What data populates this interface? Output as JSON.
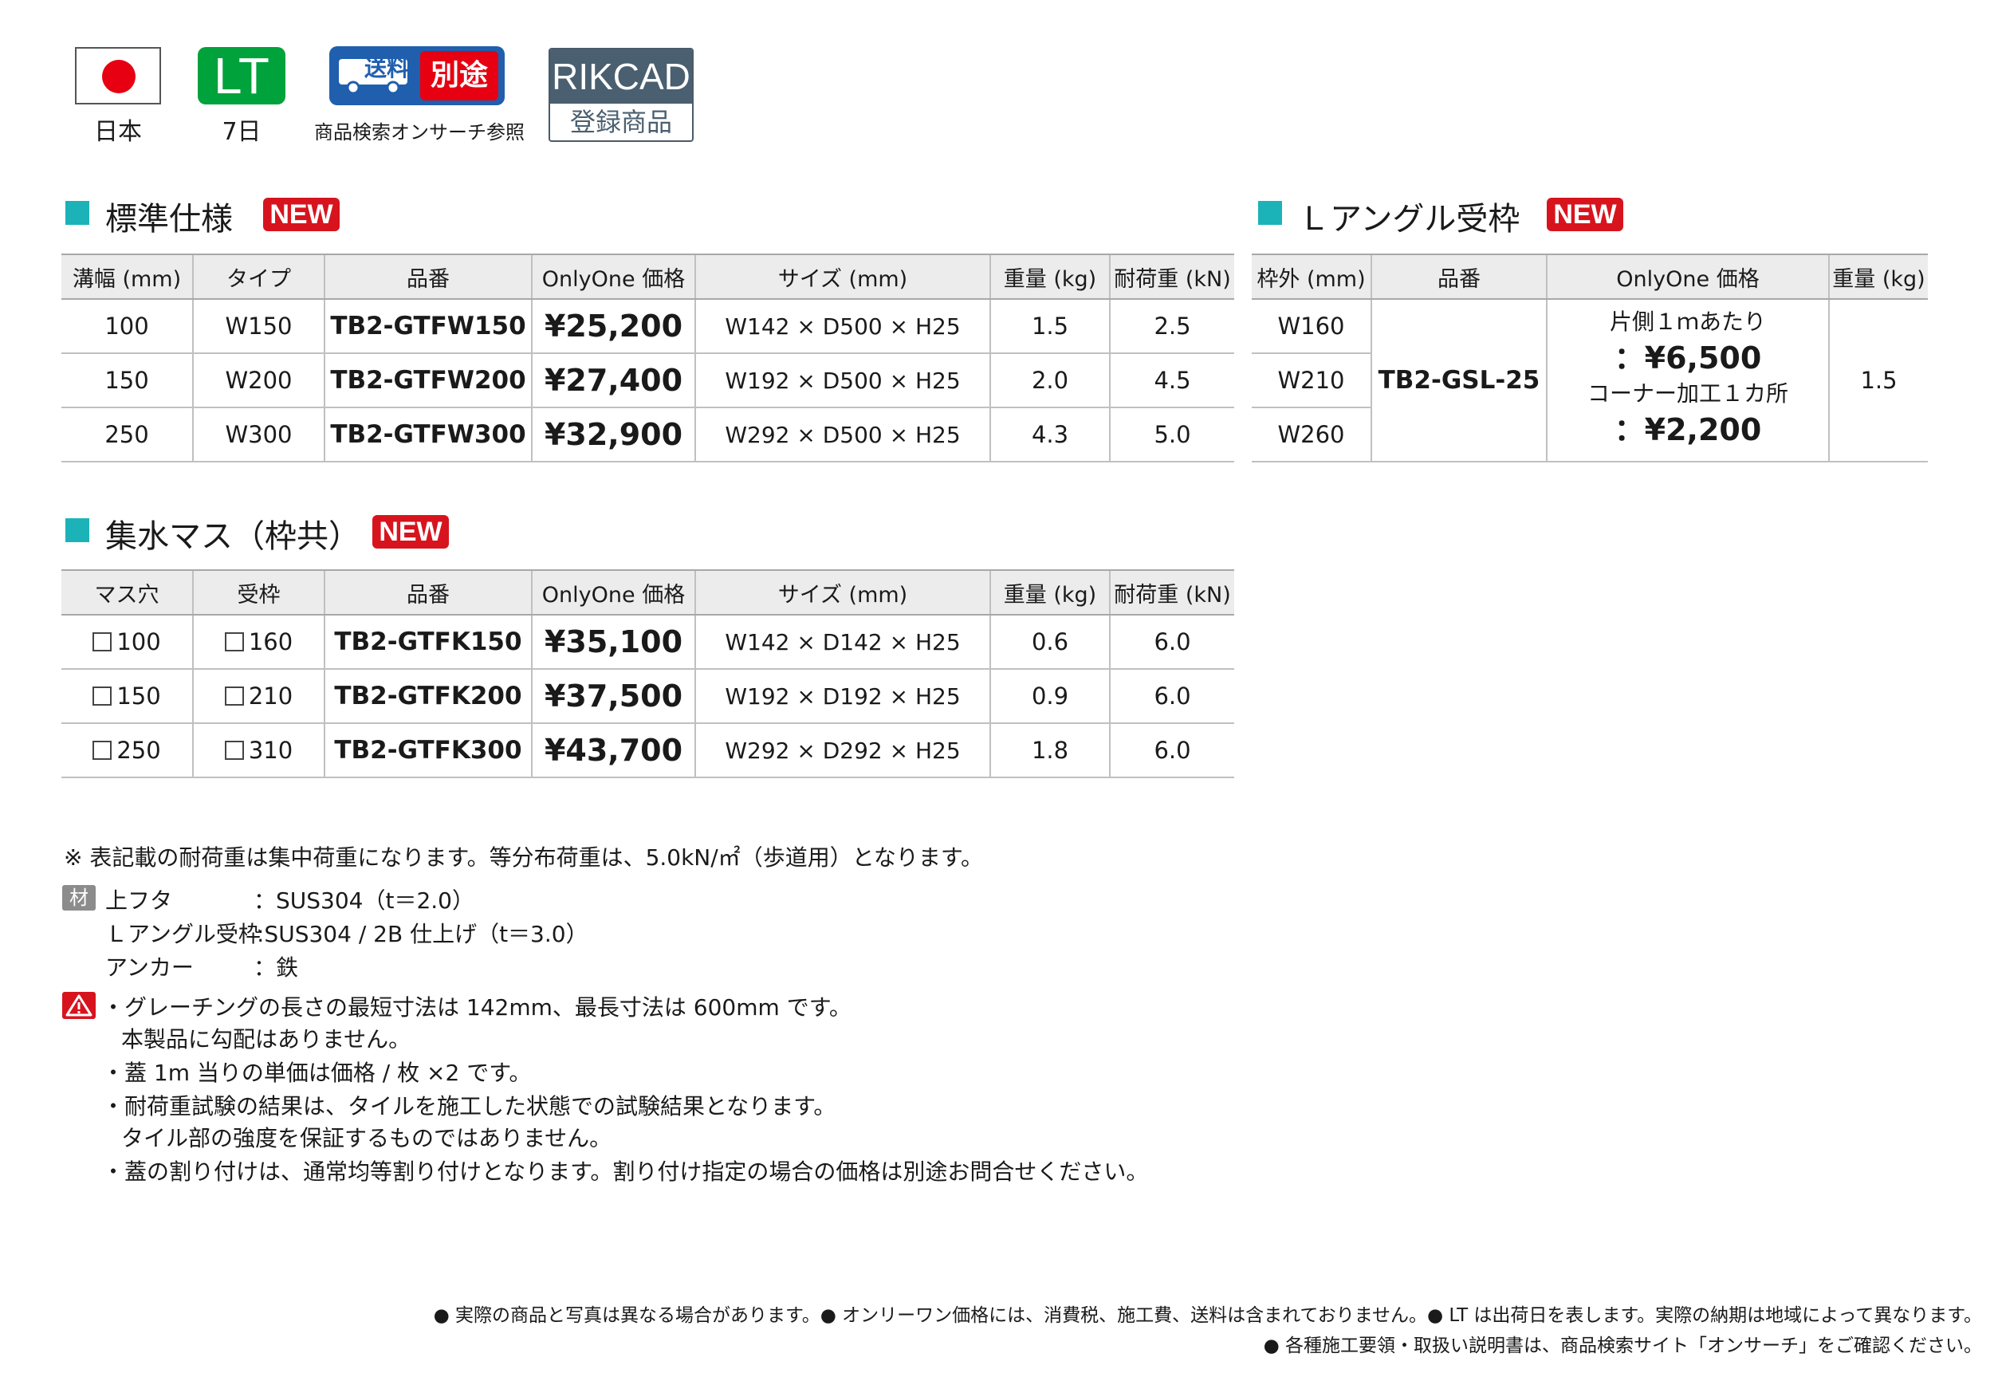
{
  "badges": {
    "origin_caption": "日本",
    "lt_label": "LT",
    "lt_caption": "7日",
    "ship_label_1": "送料",
    "ship_label_2": "別途",
    "ship_caption": "商品検索オンサーチ参照",
    "rikcad_top": "RIKCAD",
    "rikcad_bottom": "登録商品"
  },
  "colors": {
    "accent": "#1bb3b8",
    "new_badge": "#d7141e",
    "lt_green": "#00a23c",
    "ship_blue": "#1f5fae"
  },
  "standard": {
    "title": "標準仕様",
    "new_label": "NEW",
    "headers": [
      "溝幅 (mm)",
      "タイプ",
      "品番",
      "OnlyOne 価格",
      "サイズ (mm)",
      "重量 (kg)",
      "耐荷重 (kN)"
    ],
    "rows": [
      [
        "100",
        "W150",
        "TB2-GTFW150",
        "¥25,200",
        "W142 × D500 × H25",
        "1.5",
        "2.5"
      ],
      [
        "150",
        "W200",
        "TB2-GTFW200",
        "¥27,400",
        "W192 × D500 × H25",
        "2.0",
        "4.5"
      ],
      [
        "250",
        "W300",
        "TB2-GTFW300",
        "¥32,900",
        "W292 × D500 × H25",
        "4.3",
        "5.0"
      ]
    ]
  },
  "angle": {
    "title": "Ｌアングル受枠",
    "new_label": "NEW",
    "headers": [
      "枠外 (mm)",
      "品番",
      "OnlyOne 価格",
      "重量 (kg)"
    ],
    "outer_sizes": [
      "W160",
      "W210",
      "W260"
    ],
    "code": "TB2-GSL-25",
    "price_line1": "片側１ｍあたり",
    "price_value1": "：¥6,500",
    "price_line2": "コーナー加工１カ所",
    "price_value2": "：¥2,200",
    "weight": "1.5"
  },
  "catch_basin": {
    "title": "集水マス（枠共）",
    "new_label": "NEW",
    "headers": [
      "マス穴",
      "受枠",
      "品番",
      "OnlyOne 価格",
      "サイズ (mm)",
      "重量 (kg)",
      "耐荷重 (kN)"
    ],
    "rows": [
      [
        "100",
        "160",
        "TB2-GTFK150",
        "¥35,100",
        "W142 × D142 × H25",
        "0.6",
        "6.0"
      ],
      [
        "150",
        "210",
        "TB2-GTFK200",
        "¥37,500",
        "W192 × D192 × H25",
        "0.9",
        "6.0"
      ],
      [
        "250",
        "310",
        "TB2-GTFK300",
        "¥43,700",
        "W292 × D292 × H25",
        "1.8",
        "6.0"
      ]
    ]
  },
  "notes": {
    "load_note": "※ 表記載の耐荷重は集中荷重になります。等分布荷重は、5.0kN/㎡（歩道用）となります。",
    "material_icon": "材質",
    "materials": [
      {
        "name": "上フタ",
        "value": "：SUS304（t＝2.0）"
      },
      {
        "name": "Ｌアングル受枠",
        "value": ":SUS304 / 2B 仕上げ（t＝3.0）"
      },
      {
        "name": "アンカー",
        "value": "：鉄"
      }
    ],
    "warnings": [
      "・グレーチングの長さの最短寸法は 142mm、最長寸法は 600mm です。",
      "本製品に勾配はありません。",
      "・蓋 1m 当りの単価は価格 / 枚 ×2 です。",
      "・耐荷重試験の結果は、タイルを施工した状態での試験結果となります。",
      "タイル部の強度を保証するものではありません。",
      "・蓋の割り付けは、通常均等割り付けとなります。割り付け指定の場合の価格は別途お問合せください。"
    ]
  },
  "footer": {
    "line1": "● 実際の商品と写真は異なる場合があります。● オンリーワン価格には、消費税、施工費、送料は含まれておりません。● LT は出荷日を表します。実際の納期は地域によって異なります。",
    "line2": "● 各種施工要領・取扱い説明書は、商品検索サイト「オンサーチ」をご確認ください。"
  }
}
